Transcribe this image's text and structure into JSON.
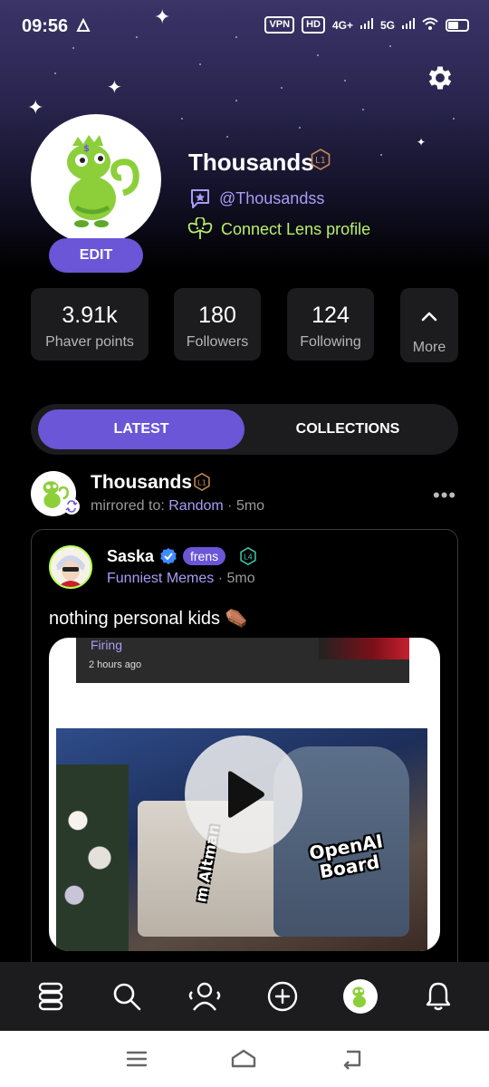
{
  "status_bar": {
    "time": "09:56",
    "vpn": "VPN",
    "hd": "HD",
    "network1": "4G+",
    "network2": "5G"
  },
  "profile": {
    "name": "Thousands",
    "level": "L1",
    "handle": "@Thousandss",
    "lens_link": "Connect Lens profile",
    "edit_label": "EDIT"
  },
  "stats": [
    {
      "value": "3.91k",
      "label": "Phaver points"
    },
    {
      "value": "180",
      "label": "Followers"
    },
    {
      "value": "124",
      "label": "Following"
    }
  ],
  "more_label": "More",
  "tabs": {
    "latest": "LATEST",
    "collections": "COLLECTIONS"
  },
  "post": {
    "author": "Thousands",
    "author_level": "L1",
    "meta_prefix": "mirrored to:",
    "meta_channel": "Random",
    "meta_time": " · 5mo",
    "quoted": {
      "author": "Saska",
      "badge": "frens",
      "level": "L4",
      "channel": "Funniest Memes",
      "time": " · 5mo",
      "text": "nothing personal kids ⚰️",
      "media": {
        "top_label": "Firing",
        "top_time": "2 hours ago",
        "overlay_label_1": "OpenAI Board",
        "overlay_label_2": "m Altman"
      }
    }
  },
  "colors": {
    "accent": "#6a56d6",
    "link": "#a99cf7",
    "lens": "#b6f06a",
    "card": "#1c1c1e"
  }
}
